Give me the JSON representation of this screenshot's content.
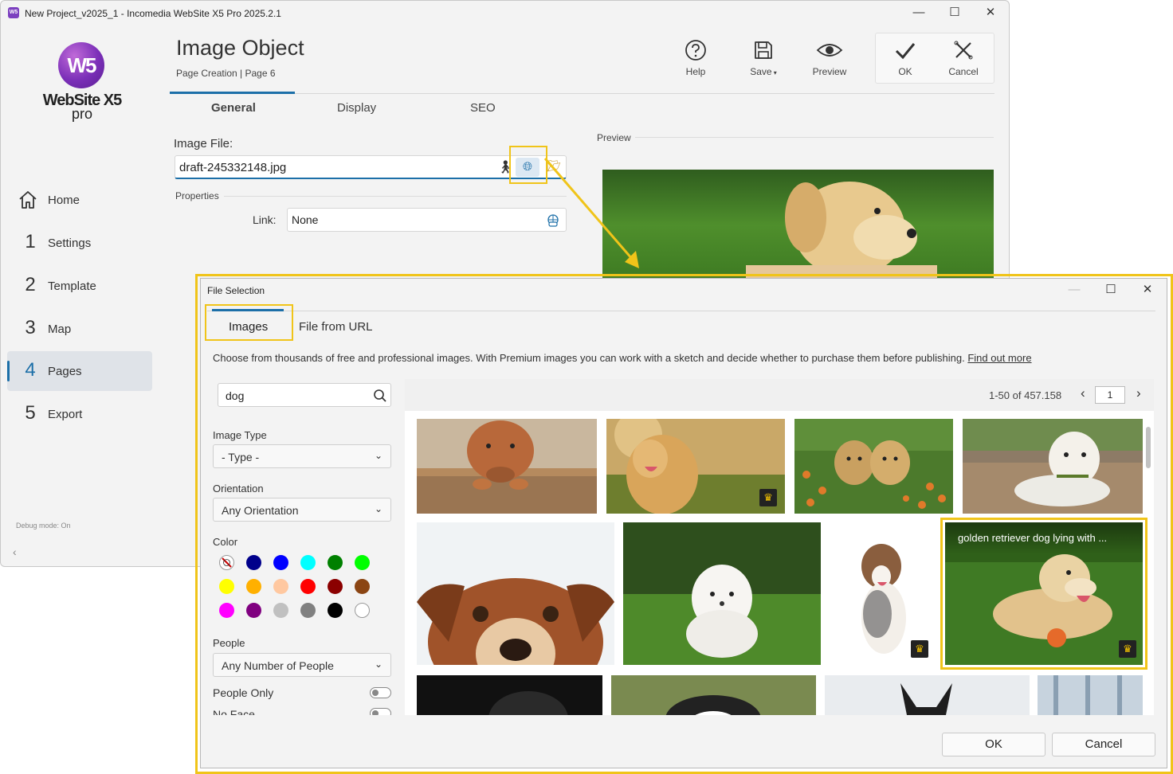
{
  "window": {
    "title": "New Project_v2025_1 - Incomedia WebSite X5 Pro 2025.2.1",
    "app_icon": "W5",
    "minimize": "—",
    "maximize": "☐",
    "close": "✕"
  },
  "logo": {
    "mark": "W5",
    "name": "WebSite X5",
    "edition": "pro"
  },
  "sidebar": {
    "items": [
      {
        "num": "",
        "label": "Home",
        "icon": "home-icon"
      },
      {
        "num": "1",
        "label": "Settings"
      },
      {
        "num": "2",
        "label": "Template"
      },
      {
        "num": "3",
        "label": "Map"
      },
      {
        "num": "4",
        "label": "Pages",
        "active": true
      },
      {
        "num": "5",
        "label": "Export"
      }
    ],
    "debug": "Debug mode: On",
    "collapse": "‹"
  },
  "header": {
    "title": "Image Object",
    "breadcrumb": "Page Creation | Page 6"
  },
  "toolbar": {
    "help": "Help",
    "save": "Save",
    "preview": "Preview",
    "ok": "OK",
    "cancel": "Cancel"
  },
  "tabs": [
    "General",
    "Display",
    "SEO"
  ],
  "form": {
    "image_file_label": "Image File:",
    "image_file_value": "draft-245332148.jpg",
    "properties_label": "Properties",
    "link_label": "Link:",
    "link_value": "None",
    "preview_label": "Preview"
  },
  "dialog": {
    "title": "File Selection",
    "tabs": [
      "Images",
      "File from URL"
    ],
    "description": "Choose from thousands of free and professional images. With Premium images you can work with a sketch and decide whether to purchase them before publishing.",
    "find_out_more": "Find out more",
    "search_value": "dog",
    "image_type_label": "Image Type",
    "image_type_value": "- Type -",
    "orientation_label": "Orientation",
    "orientation_value": "Any Orientation",
    "color_label": "Color",
    "colors": [
      "#ffffff",
      "#00008b",
      "#0000ff",
      "#00ffff",
      "#008000",
      "#00ff00",
      "#ffff00",
      "#ffb000",
      "#ffc8a0",
      "#ff0000",
      "#8b0000",
      "#8b4513",
      "#ff00ff",
      "#800080",
      "#c0c0c0",
      "#808080",
      "#000000",
      "#ffffff"
    ],
    "people_label": "People",
    "people_value": "Any Number of People",
    "people_only_label": "People Only",
    "no_face_label": "No Face",
    "results": "1-50 of 457.158",
    "page": "1",
    "tooltip": "golden retriever dog lying with ...",
    "ok": "OK",
    "cancel": "Cancel"
  },
  "colors": {
    "accent": "#1c6fa8",
    "highlight": "#f0c419",
    "premium": "#f5c400"
  }
}
